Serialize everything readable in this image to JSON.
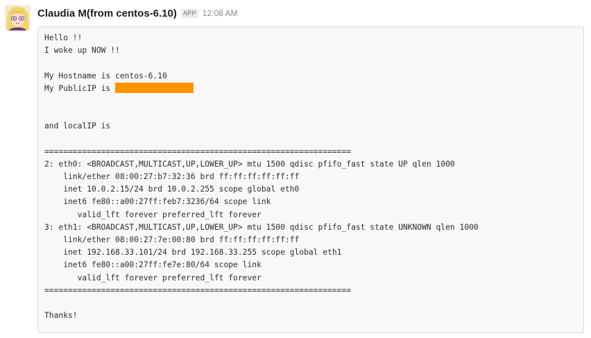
{
  "message": {
    "sender": "Claudia M(from centos-6.10)",
    "badge": "APP",
    "time": "12:08 AM",
    "avatar_icon": "anime-girl-avatar",
    "redaction_color": "#ff9400",
    "lines": [
      "Hello !!",
      "I woke up NOW !!",
      "",
      "My Hostname is centos-6.10",
      "My PublicIP is ",
      "",
      "",
      "and localIP is",
      "",
      "=================================================================",
      "2: eth0: <BROADCAST,MULTICAST,UP,LOWER_UP> mtu 1500 qdisc pfifo_fast state UP qlen 1000",
      "    link/ether 08:00:27:b7:32:36 brd ff:ff:ff:ff:ff:ff",
      "    inet 10.0.2.15/24 brd 10.0.2.255 scope global eth0",
      "    inet6 fe80::a00:27ff:feb7:3236/64 scope link",
      "       valid_lft forever preferred_lft forever",
      "3: eth1: <BROADCAST,MULTICAST,UP,LOWER_UP> mtu 1500 qdisc pfifo_fast state UNKNOWN qlen 1000",
      "    link/ether 08:00:27:7e:00:80 brd ff:ff:ff:ff:ff:ff",
      "    inet 192.168.33.101/24 brd 192.168.33.255 scope global eth1",
      "    inet6 fe80::a00:27ff:fe7e:80/64 scope link",
      "       valid_lft forever preferred_lft forever",
      "=================================================================",
      "",
      "Thanks!"
    ]
  }
}
